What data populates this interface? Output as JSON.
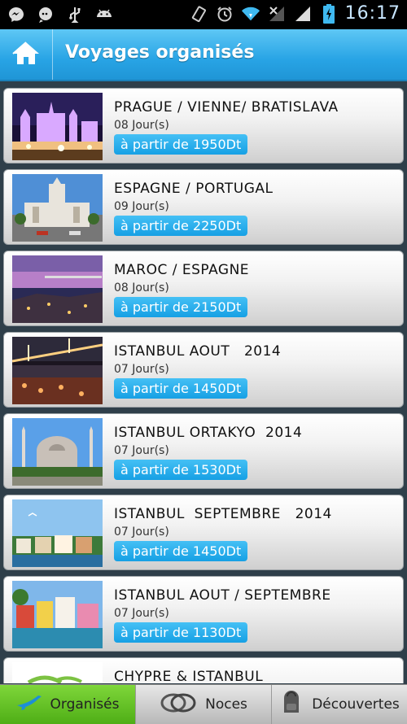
{
  "status_bar": {
    "time": "16:17",
    "icons_left": [
      "messenger-icon",
      "chat-icon",
      "usb-icon",
      "android-icon"
    ],
    "icons_right": [
      "vibrate-icon",
      "alarm-icon",
      "wifi-icon",
      "no-signal-icon",
      "signal-icon",
      "battery-charging-icon"
    ]
  },
  "header": {
    "home_icon": "home-icon",
    "title": "Voyages organisés"
  },
  "trips": [
    {
      "name": "PRAGUE / VIENNE/ BRATISLAVA",
      "days": "08 Jour(s)",
      "price": "à partir de 1950Dt",
      "image": "prague-night-square"
    },
    {
      "name": "ESPAGNE / PORTUGAL",
      "days": "09 Jour(s)",
      "price": "à partir de 2250Dt",
      "image": "madrid-palace"
    },
    {
      "name": "MAROC / ESPAGNE",
      "days": "08 Jour(s)",
      "price": "à partir de 2150Dt",
      "image": "coastal-city-dusk"
    },
    {
      "name": "ISTANBUL AOUT   2014",
      "days": "07 Jour(s)",
      "price": "à partir de 1450Dt",
      "image": "bosphorus-bridge-night"
    },
    {
      "name": "ISTANBUL ORTAKYO  2014",
      "days": "07 Jour(s)",
      "price": "à partir de 1530Dt",
      "image": "blue-mosque"
    },
    {
      "name": "ISTANBUL  SEPTEMBRE   2014",
      "days": "07 Jour(s)",
      "price": "à partir de 1450Dt",
      "image": "bosphorus-waterfront-houses"
    },
    {
      "name": "ISTANBUL AOUT / SEPTEMBRE",
      "days": "07 Jour(s)",
      "price": "à partir de 1130Dt",
      "image": "colorful-waterfront-houses"
    },
    {
      "name": "CHYPRE & ISTANBUL",
      "days": "",
      "price": "",
      "image": "cyprus-logo"
    }
  ],
  "tabs": [
    {
      "label": "Organisés",
      "icon": "airplane-icon",
      "active": true
    },
    {
      "label": "Noces",
      "icon": "rings-icon",
      "active": false
    },
    {
      "label": "Découvertes",
      "icon": "backpack-icon",
      "active": false
    }
  ]
}
